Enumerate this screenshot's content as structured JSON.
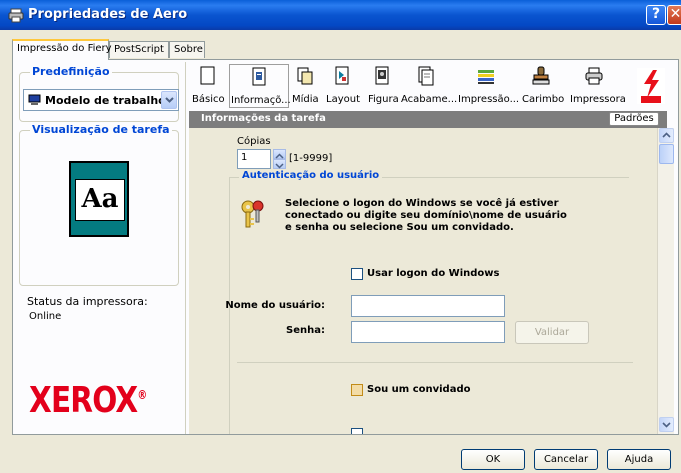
{
  "window": {
    "title": "Propriedades de Aero",
    "help_label": "?",
    "close_label": "✕"
  },
  "tabs": [
    {
      "label": "Impressão do Fiery",
      "active": true
    },
    {
      "label": "PostScript",
      "active": false
    },
    {
      "label": "Sobre",
      "active": false
    }
  ],
  "sidebar": {
    "preset_title": "Predefinição",
    "preset_value": "Modelo de trabalho",
    "preview_title": "Visualização de tarefa",
    "preview_text": "Aa",
    "status_label": "Status da impressora:",
    "status_value": "Online",
    "brand": "XEROX",
    "brand_mark": "®"
  },
  "toolbar": [
    {
      "label": "Básico",
      "icon": "blank-page-icon",
      "selected": false
    },
    {
      "label": "Informaçõ...",
      "icon": "info-page-icon",
      "selected": true
    },
    {
      "label": "Mídia",
      "icon": "media-icon",
      "selected": false
    },
    {
      "label": "Layout",
      "icon": "layout-icon",
      "selected": false
    },
    {
      "label": "Figura",
      "icon": "image-icon",
      "selected": false
    },
    {
      "label": "Acabame...",
      "icon": "finishing-icon",
      "selected": false
    },
    {
      "label": "Impressão...",
      "icon": "color-stack-icon",
      "selected": false
    },
    {
      "label": "Carimbo",
      "icon": "stamp-icon",
      "selected": false
    },
    {
      "label": "Impressora",
      "icon": "printer-icon",
      "selected": false
    }
  ],
  "section": {
    "title": "Informações da tarefa",
    "defaults_label": "Padrões"
  },
  "copies": {
    "label": "Cópias",
    "value": "1",
    "range": "[1-9999]"
  },
  "auth": {
    "title": "Autenticação do usuário",
    "description": "Selecione o logon do Windows se você já estiver conectado ou digite seu domínio\\nome de usuário e senha ou selecione Sou um convidado.",
    "use_windows_logon": "Usar logon do Windows",
    "username_label": "Nome do usuário:",
    "password_label": "Senha:",
    "validate_label": "Validar",
    "guest_label": "Sou um convidado"
  },
  "footer": {
    "ok": "OK",
    "cancel": "Cancelar",
    "help": "Ajuda"
  },
  "colors": {
    "accent": "#0046d5",
    "title_bar": "#0a55d0",
    "brand": "#e3001b",
    "preview_bg": "#047b81"
  }
}
